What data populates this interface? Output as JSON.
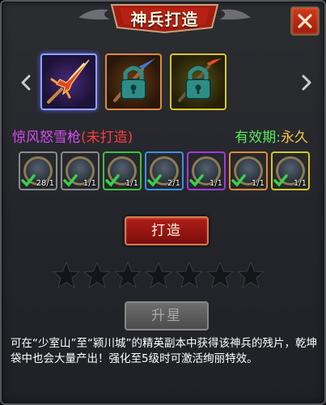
{
  "header": {
    "title": "神兵打造"
  },
  "weapons": [
    {
      "name": "spear-weapon-icon",
      "frame": "#8aa6ff",
      "locked": false
    },
    {
      "name": "locked-spear-icon",
      "frame": "#e08a3c",
      "locked": true
    },
    {
      "name": "locked-spear-icon",
      "frame": "#d8c52b",
      "locked": true
    }
  ],
  "weapon_info": {
    "name": "惊风怒雪枪",
    "status": "(未打造)",
    "validity_label": "有效期:",
    "validity_value": "永久"
  },
  "fragments": [
    {
      "count": "28/1",
      "frame": "#8a8a8a"
    },
    {
      "count": "1/1",
      "frame": "#8a8a8a"
    },
    {
      "count": "1/1",
      "frame": "#3ec23e"
    },
    {
      "count": "2/1",
      "frame": "#3f8fe0"
    },
    {
      "count": "1/1",
      "frame": "#a13ad8"
    },
    {
      "count": "1/1",
      "frame": "#e08a3c"
    },
    {
      "count": "1/1",
      "frame": "#d8c52b"
    }
  ],
  "forge_button": {
    "label": "打造"
  },
  "stars": {
    "filled": 0,
    "total": 7
  },
  "upgrade_button": {
    "label": "升星"
  },
  "description": "可在“少室山”至“颍川城”的精英副本中获得该神兵的残片，乾坤袋中也会大量产出！强化至5级时可激活绚丽特效。"
}
